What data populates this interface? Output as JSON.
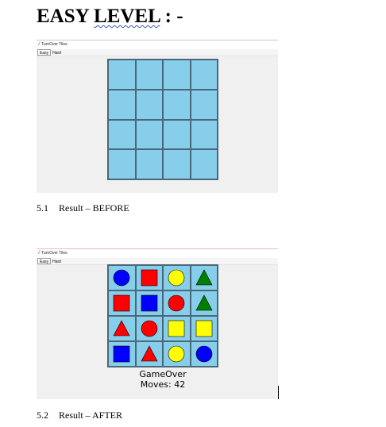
{
  "heading": {
    "prefix": "EASY ",
    "underlined": "LEVEL",
    "suffix": " : -"
  },
  "window_before": {
    "title": "TurnOver Tiles",
    "menu": [
      "Easy",
      "Hard"
    ],
    "active_menu": "Easy"
  },
  "window_after": {
    "title": "TurnOver Tiles",
    "menu": [
      "Easy",
      "Hard"
    ],
    "active_menu": "Easy",
    "status_line1": "GameOver",
    "status_line2": "Moves: 42",
    "tiles": [
      [
        "blue-circle",
        "red-square",
        "yellow-circle",
        "green-triangle"
      ],
      [
        "red-square",
        "blue-square",
        "red-circle",
        "green-triangle"
      ],
      [
        "red-triangle",
        "red-circle",
        "yellow-square",
        "yellow-square"
      ],
      [
        "blue-square",
        "red-triangle",
        "yellow-circle",
        "blue-circle"
      ]
    ]
  },
  "captions": {
    "before": {
      "number": "5.1",
      "text": "Result – BEFORE"
    },
    "after": {
      "number": "5.2",
      "text": "Result – AFTER"
    }
  },
  "colors": {
    "tile_bg": "#87ceeb",
    "red": "#ff0000",
    "blue": "#0000ff",
    "yellow": "#ffff00",
    "green": "#008000"
  }
}
